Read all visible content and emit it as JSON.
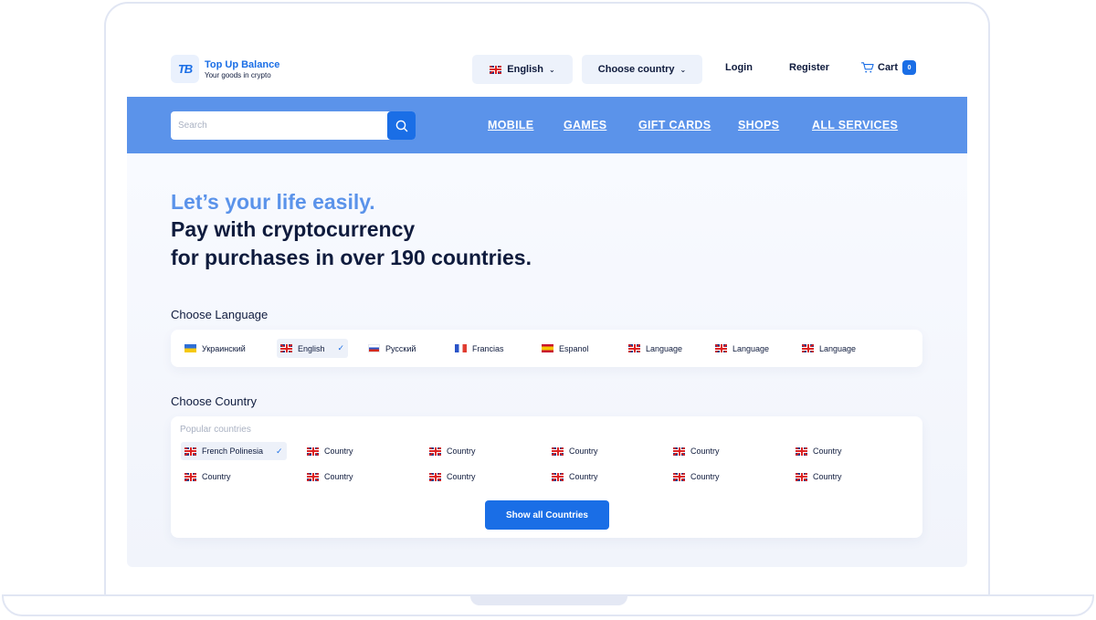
{
  "header": {
    "logo_mark": "TB",
    "logo_title": "Top Up Balance",
    "logo_subtitle": "Your goods in crypto",
    "language_selector": "English",
    "country_selector": "Choose country",
    "login": "Login",
    "register": "Register",
    "cart_label": "Cart",
    "cart_count": "0"
  },
  "navbar": {
    "search_placeholder": "Search",
    "items": [
      "MOBILE",
      "GAMES",
      "GIFT CARDS",
      "SHOPS",
      "ALL SERVICES"
    ]
  },
  "hero": {
    "line1": "Let’s your life easily.",
    "line2": "Pay with cryptocurrency",
    "line3": "for purchases in over 190 countries."
  },
  "languages": {
    "title": "Choose Language",
    "items": [
      {
        "label": "Украинский",
        "flag": "ua",
        "selected": false
      },
      {
        "label": "English",
        "flag": "uk",
        "selected": true
      },
      {
        "label": "Русский",
        "flag": "ru",
        "selected": false
      },
      {
        "label": "Francias",
        "flag": "fr",
        "selected": false
      },
      {
        "label": "Espanol",
        "flag": "es",
        "selected": false
      },
      {
        "label": "Language",
        "flag": "uk",
        "selected": false
      },
      {
        "label": "Language",
        "flag": "uk",
        "selected": false
      },
      {
        "label": "Language",
        "flag": "uk",
        "selected": false
      }
    ]
  },
  "countries": {
    "title": "Choose Country",
    "subtitle": "Popular countries",
    "items": [
      {
        "label": "French Polinesia",
        "selected": true
      },
      {
        "label": "Country",
        "selected": false
      },
      {
        "label": "Country",
        "selected": false
      },
      {
        "label": "Country",
        "selected": false
      },
      {
        "label": "Country",
        "selected": false
      },
      {
        "label": "Country",
        "selected": false
      },
      {
        "label": "Country",
        "selected": false
      },
      {
        "label": "Country",
        "selected": false
      },
      {
        "label": "Country",
        "selected": false
      },
      {
        "label": "Country",
        "selected": false
      },
      {
        "label": "Country",
        "selected": false
      },
      {
        "label": "Country",
        "selected": false
      }
    ],
    "show_all": "Show all Countries"
  },
  "colors": {
    "accent": "#1a6ee6",
    "navbar": "#5b93ea",
    "text": "#0f1b3d"
  }
}
